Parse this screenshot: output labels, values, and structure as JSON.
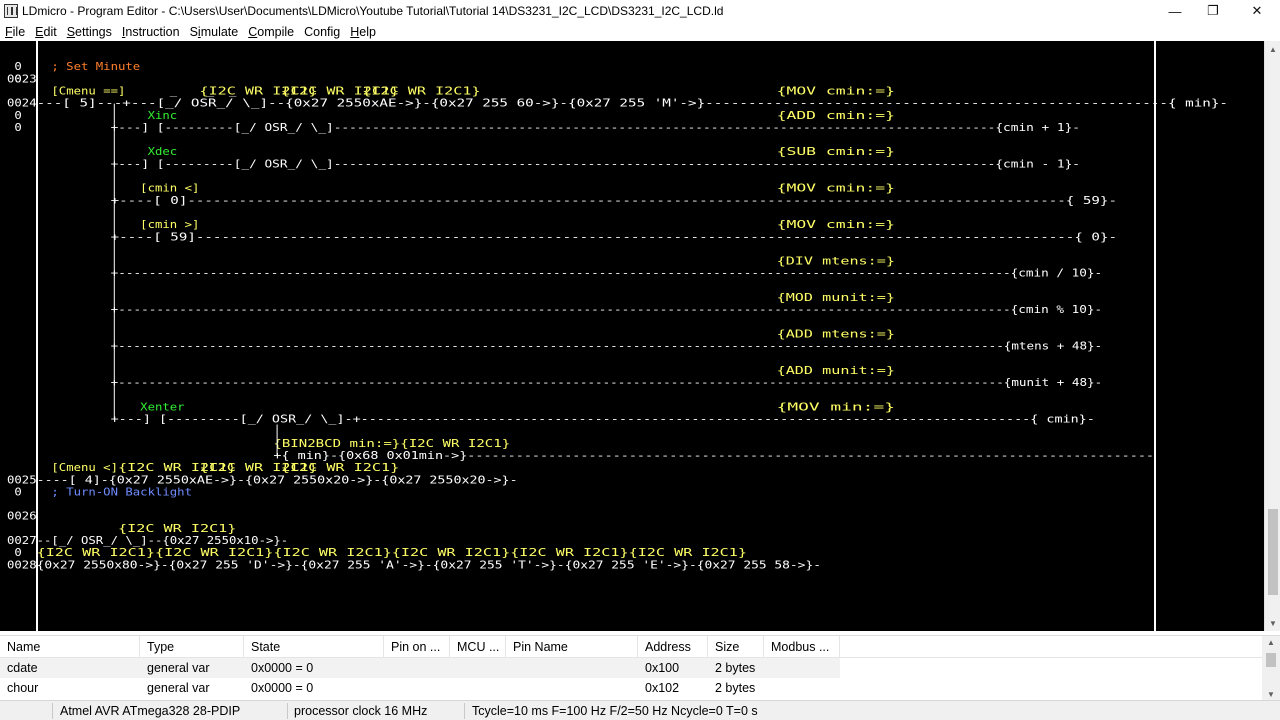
{
  "window": {
    "title": "LDmicro - Program Editor - C:\\Users\\User\\Documents\\LDMicro\\Youtube Tutorial\\Tutorial 14\\DS3231_I2C_LCD\\DS3231_I2C_LCD.ld",
    "minimize_glyph": "—",
    "restore_glyph": "❐",
    "close_glyph": "✕"
  },
  "menu": [
    {
      "pre": "",
      "acc": "F",
      "post": "ile"
    },
    {
      "pre": "",
      "acc": "E",
      "post": "dit"
    },
    {
      "pre": "",
      "acc": "S",
      "post": "ettings"
    },
    {
      "pre": "",
      "acc": "I",
      "post": "nstruction"
    },
    {
      "pre": "S",
      "acc": "i",
      "post": "mulate"
    },
    {
      "pre": "",
      "acc": "C",
      "post": "ompile"
    },
    {
      "pre": "",
      "acc": "",
      "post": "Config"
    },
    {
      "pre": "",
      "acc": "H",
      "post": "elp"
    }
  ],
  "colors": {
    "background": "#000000",
    "wire": "#ffffff",
    "comment": "#ff7f2a",
    "comment_blue": "#6f8cff",
    "element_name": "#ffff66",
    "input_name": "#33ee33",
    "operator": "#ffffff",
    "rung_number": "#ffffff"
  },
  "rungs": [
    {
      "num": "0023",
      "comment": "; Set Minute"
    },
    {
      "num": "0024"
    },
    {
      "num": "0025"
    },
    {
      "num": "0026",
      "comment": "; Turn-ON Backlight"
    },
    {
      "num": "0027"
    },
    {
      "num": "0028"
    }
  ],
  "ladder_text": [
    {
      "row": 1,
      "col": 1,
      "t": "0",
      "c": "rung_number"
    },
    {
      "row": 2,
      "col": 1,
      "t": "0",
      "c": "rung_number"
    },
    {
      "row": 3,
      "col": 6,
      "t": "[Cmenu ==]",
      "c": "element_name"
    },
    {
      "row": 3,
      "col": 22,
      "t": "_",
      "c": "wire"
    },
    {
      "row": 3,
      "col": 27,
      "t": "_",
      "c": "wire"
    },
    {
      "row": 3,
      "col": 30,
      "t": "_",
      "c": "wire"
    },
    {
      "row": 3,
      "col": 26,
      "t": "{I2C WR    I2C1}",
      "c": "element_name"
    },
    {
      "row": 3,
      "col": 37,
      "t": "{I2C WR    I2C1}",
      "c": "element_name"
    },
    {
      "row": 3,
      "col": 48,
      "t": "{I2C WR    I2C1}",
      "c": "element_name"
    },
    {
      "row": 3,
      "col": 104,
      "t": "{MOV     cmin:=}",
      "c": "element_name"
    },
    {
      "row": 4,
      "col": 0,
      "t": "0024",
      "c": "rung_number"
    },
    {
      "row": 4,
      "col": 4,
      "t": "---[       5]---+---[_/ OSR_/ \\_]--{0x27 2550xAE->}-{0x27  255 60->}-{0x27 255  'M'->}------------------------------------------------------{               min}-",
      "c": "wire"
    },
    {
      "row": 5,
      "col": 1,
      "t": "0",
      "c": "rung_number"
    },
    {
      "row": 5,
      "col": 19,
      "t": "Xinc",
      "c": "input_name"
    },
    {
      "row": 5,
      "col": 104,
      "t": "{ADD     cmin:=}",
      "c": "element_name"
    },
    {
      "row": 6,
      "col": 1,
      "t": "0",
      "c": "rung_number"
    },
    {
      "row": 6,
      "col": 14,
      "t": "+---] [---------[_/ OSR_/ \\_]--------------------------------------------------------------------------------------{cmin    +   1}-",
      "c": "wire"
    },
    {
      "row": 8,
      "col": 19,
      "t": "Xdec",
      "c": "input_name"
    },
    {
      "row": 8,
      "col": 104,
      "t": "{SUB     cmin:=}",
      "c": "element_name"
    },
    {
      "row": 9,
      "col": 14,
      "t": "+---] [---------[_/ OSR_/ \\_]--------------------------------------------------------------------------------------{cmin    -   1}-",
      "c": "wire"
    },
    {
      "row": 11,
      "col": 18,
      "t": "[cmin <]",
      "c": "element_name"
    },
    {
      "row": 11,
      "col": 104,
      "t": "{MOV     cmin:=}",
      "c": "element_name"
    },
    {
      "row": 12,
      "col": 14,
      "t": "+----[     0]-------------------------------------------------------------------------------------------------------{               59}-",
      "c": "wire"
    },
    {
      "row": 14,
      "col": 18,
      "t": "[cmin >]",
      "c": "element_name"
    },
    {
      "row": 14,
      "col": 104,
      "t": "{MOV     cmin:=}",
      "c": "element_name"
    },
    {
      "row": 15,
      "col": 14,
      "t": "+----[    59]-------------------------------------------------------------------------------------------------------{                0}-",
      "c": "wire"
    },
    {
      "row": 17,
      "col": 104,
      "t": "{DIV    mtens:=}",
      "c": "element_name"
    },
    {
      "row": 18,
      "col": 14,
      "t": "+---------------------------------------------------------------------------------------------------------------------{cmin    /  10}-",
      "c": "wire"
    },
    {
      "row": 20,
      "col": 104,
      "t": "{MOD    munit:=}",
      "c": "element_name"
    },
    {
      "row": 21,
      "col": 14,
      "t": "+---------------------------------------------------------------------------------------------------------------------{cmin    %  10}-",
      "c": "wire"
    },
    {
      "row": 23,
      "col": 104,
      "t": "{ADD    mtens:=}",
      "c": "element_name"
    },
    {
      "row": 24,
      "col": 14,
      "t": "+---------------------------------------------------------------------------------------------------------------------{mtens   +  48}-",
      "c": "wire"
    },
    {
      "row": 26,
      "col": 104,
      "t": "{ADD    munit:=}",
      "c": "element_name"
    },
    {
      "row": 27,
      "col": 14,
      "t": "+---------------------------------------------------------------------------------------------------------------------{munit   +  48}-",
      "c": "wire"
    },
    {
      "row": 29,
      "col": 18,
      "t": "Xenter",
      "c": "input_name"
    },
    {
      "row": 29,
      "col": 104,
      "t": "{MOV      min:=}",
      "c": "element_name"
    },
    {
      "row": 30,
      "col": 14,
      "t": "+---] [---------[_/ OSR_/ \\_]-+-----------------------------------------------------------------------------------{            cmin}-",
      "c": "wire"
    },
    {
      "row": 32,
      "col": 36,
      "t": "{BIN2BCD  min:=}{I2C WR    I2C1}",
      "c": "element_name"
    },
    {
      "row": 33,
      "col": 36,
      "t": "+{           min}-{0x68 0x01min->}-------------------------------------------------------------------------------------",
      "c": "wire"
    },
    {
      "row": 34,
      "col": 6,
      "t": "[Cmenu <]",
      "c": "element_name"
    },
    {
      "row": 34,
      "col": 15,
      "t": "{I2C WR    I2C1}",
      "c": "element_name"
    },
    {
      "row": 34,
      "col": 26,
      "t": "{I2C WR    I2C1}",
      "c": "element_name"
    },
    {
      "row": 34,
      "col": 37,
      "t": "{I2C WR    I2C1}",
      "c": "element_name"
    },
    {
      "row": 35,
      "col": 0,
      "t": "0025",
      "c": "rung_number"
    },
    {
      "row": 35,
      "col": 4,
      "t": "----[      4]-{0x27 2550xAE->}-{0x27 2550x20->}-{0x27 2550x20->}-",
      "c": "wire"
    },
    {
      "row": 36,
      "col": 1,
      "t": "0",
      "c": "rung_number"
    },
    {
      "row": 39,
      "col": 15,
      "t": "{I2C WR    I2C1}",
      "c": "element_name"
    },
    {
      "row": 40,
      "col": 0,
      "t": "0027",
      "c": "rung_number"
    },
    {
      "row": 40,
      "col": 4,
      "t": "--[_/ OSR_/ \\_]--{0x27 2550x10->}-",
      "c": "wire"
    },
    {
      "row": 41,
      "col": 1,
      "t": "0",
      "c": "rung_number"
    },
    {
      "row": 41,
      "col": 4,
      "t": "{I2C WR    I2C1}{I2C WR    I2C1}{I2C WR    I2C1}{I2C WR    I2C1}{I2C WR    I2C1}{I2C WR    I2C1}",
      "c": "element_name"
    },
    {
      "row": 42,
      "col": 0,
      "t": "0028",
      "c": "rung_number"
    },
    {
      "row": 42,
      "col": 4,
      "t": "{0x27 2550x80->}-{0x27 255  'D'->}-{0x27 255  'A'->}-{0x27 255  'T'->}-{0x27 255  'E'->}-{0x27  255 58->}-",
      "c": "wire"
    }
  ],
  "iolist": {
    "headers": [
      "Name",
      "Type",
      "State",
      "Pin on ...",
      "MCU ...",
      "Pin Name",
      "Address",
      "Size",
      "Modbus ..."
    ],
    "rows": [
      [
        "cdate",
        "general var",
        "0x0000 = 0",
        "",
        "",
        "",
        "0x100",
        "2 bytes",
        ""
      ],
      [
        "chour",
        "general var",
        "0x0000 = 0",
        "",
        "",
        "",
        "0x102",
        "2 bytes",
        ""
      ]
    ]
  },
  "statusbar": {
    "mcu": "Atmel AVR ATmega328 28-PDIP",
    "clock": "processor clock 16 MHz",
    "timing": "Tcycle=10 ms F=100 Hz F/2=50 Hz Ncycle=0 T=0 s"
  }
}
